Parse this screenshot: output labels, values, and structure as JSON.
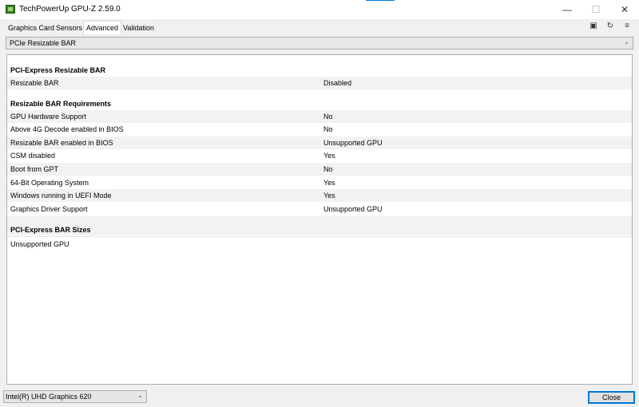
{
  "window": {
    "title": "TechPowerUp GPU-Z 2.59.0",
    "minimize_glyph": "—",
    "maximize_glyph": "☐",
    "close_glyph": "✕",
    "accent_color": "#0078d7"
  },
  "tabs": [
    {
      "label": "Graphics Card",
      "active": false
    },
    {
      "label": "Sensors",
      "active": false
    },
    {
      "label": "Advanced",
      "active": true
    },
    {
      "label": "Validation",
      "active": false
    }
  ],
  "toolbar": {
    "icons": [
      "camera-icon",
      "refresh-icon",
      "menu-icon"
    ],
    "camera_glyph": "▣",
    "refresh_glyph": "↻",
    "menu_glyph": "≡"
  },
  "page_select": {
    "value": "PCIe Resizable BAR",
    "chevron": "⌄"
  },
  "sections": {
    "bar": {
      "title": "PCI-Express Resizable BAR",
      "rows": [
        {
          "label": "Resizable BAR",
          "value": "Disabled"
        }
      ]
    },
    "requirements": {
      "title": "Resizable BAR Requirements",
      "rows": [
        {
          "label": "GPU Hardware Support",
          "value": "No"
        },
        {
          "label": "Above 4G Decode enabled in BIOS",
          "value": "No"
        },
        {
          "label": "Resizable BAR enabled in BIOS",
          "value": "Unsupported GPU"
        },
        {
          "label": "CSM disabled",
          "value": "Yes"
        },
        {
          "label": "Boot from GPT",
          "value": "No"
        },
        {
          "label": "64-Bit Operating System",
          "value": "Yes"
        },
        {
          "label": "Windows running in UEFI Mode",
          "value": "Yes"
        },
        {
          "label": "Graphics Driver Support",
          "value": "Unsupported GPU"
        }
      ]
    },
    "sizes": {
      "title": "PCI-Express BAR Sizes",
      "text": "Unsupported GPU"
    }
  },
  "footer": {
    "gpu_select": "Intel(R) UHD Graphics 620",
    "gpu_chevron": "⌄",
    "close_label": "Close"
  }
}
